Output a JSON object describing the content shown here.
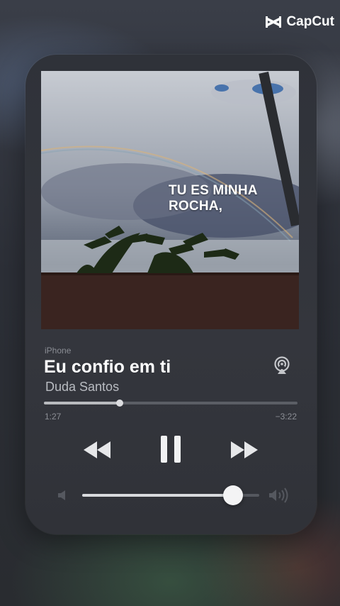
{
  "watermark": {
    "brand": "CapCut",
    "icon": "capcut-logo-icon"
  },
  "artwork": {
    "lyric_line1": "TU ES MINHA",
    "lyric_line2": "ROCHA,"
  },
  "player": {
    "source": "iPhone",
    "title": "Eu confio em ti",
    "artist": "Duda Santos",
    "elapsed": "1:27",
    "remaining": "−3:22",
    "progress_fraction": 0.3,
    "volume_fraction": 0.85,
    "icons": {
      "airplay": "airplay-icon",
      "rewind": "rewind-icon",
      "pause": "pause-icon",
      "forward": "fast-forward-icon",
      "volume_low": "volume-low-icon",
      "volume_high": "volume-high-icon"
    }
  },
  "colors": {
    "accent_text": "#ffffff",
    "secondary_text": "#8b8e95",
    "card": "#33353c"
  }
}
